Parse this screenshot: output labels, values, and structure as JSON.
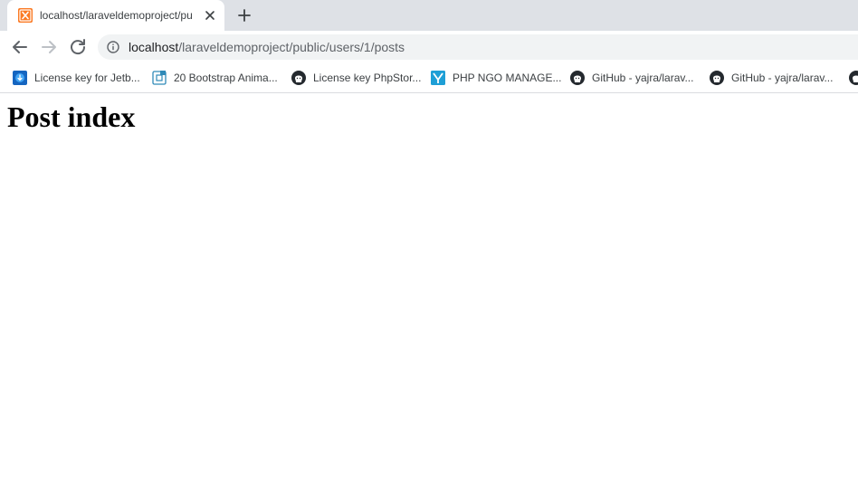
{
  "tab": {
    "title": "localhost/laraveldemoproject/pu",
    "favicon": "xampp-icon"
  },
  "toolbar": {
    "back_icon": "back-arrow-icon",
    "forward_icon": "forward-arrow-icon",
    "reload_icon": "reload-icon",
    "url_host": "localhost",
    "url_path": "/laraveldemoproject/public/users/1/posts"
  },
  "bookmarks": [
    {
      "label": "License key for Jetb...",
      "icon": "jetbrains-icon"
    },
    {
      "label": "20 Bootstrap Anima...",
      "icon": "bootstrap-page-icon"
    },
    {
      "label": "License key PhpStor...",
      "icon": "github-icon"
    },
    {
      "label": "PHP NGO MANAGE...",
      "icon": "ngo-icon"
    },
    {
      "label": "GitHub - yajra/larav...",
      "icon": "github-icon"
    },
    {
      "label": "GitHub - yajra/larav...",
      "icon": "github-icon"
    }
  ],
  "page": {
    "heading": "Post index"
  },
  "colors": {
    "tabstrip": "#dee1e6",
    "omnibox": "#f1f3f4",
    "xampp_orange": "#fb7a24"
  }
}
